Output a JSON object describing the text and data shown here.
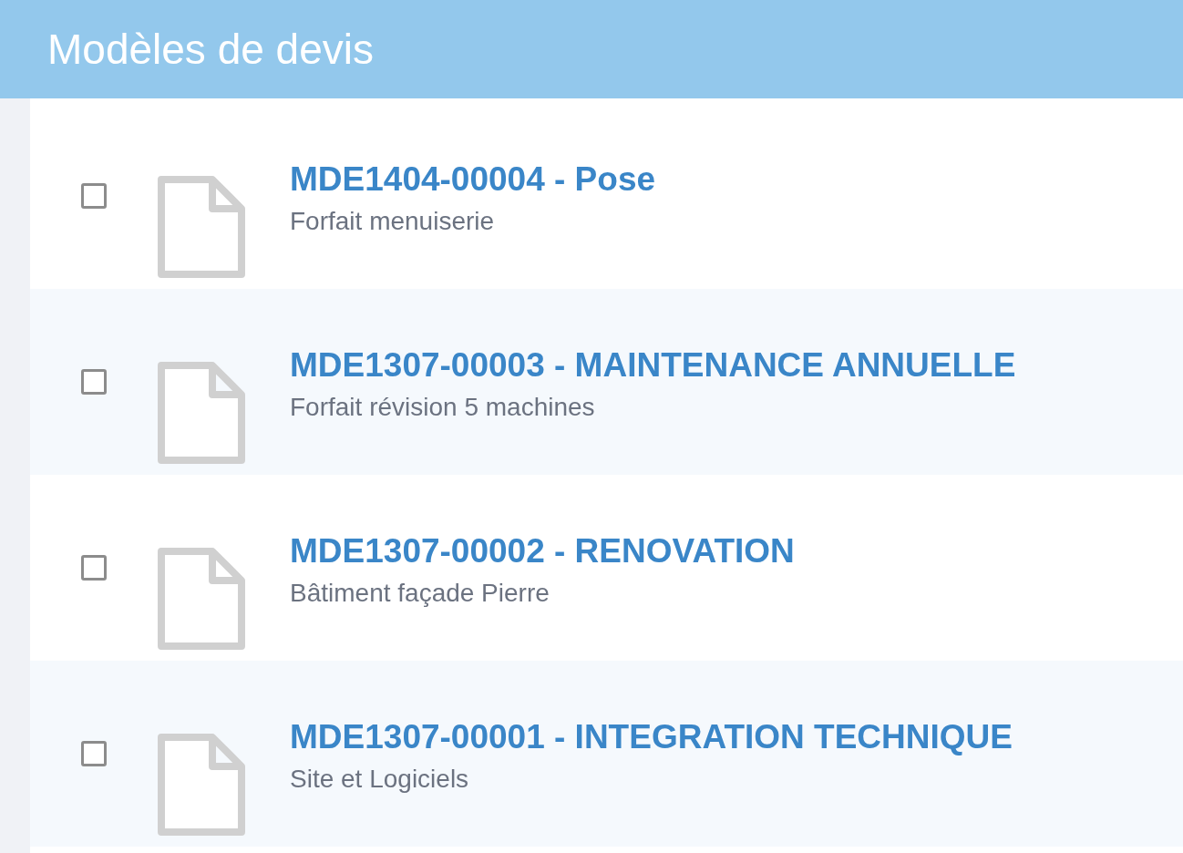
{
  "header": {
    "title": "Modèles de devis"
  },
  "items": [
    {
      "title": "MDE1404-00004 - Pose",
      "subtitle": "Forfait menuiserie",
      "checked": false
    },
    {
      "title": "MDE1307-00003 - MAINTENANCE ANNUELLE",
      "subtitle": "Forfait révision 5 machines",
      "checked": false
    },
    {
      "title": "MDE1307-00002 - RENOVATION",
      "subtitle": "Bâtiment façade Pierre",
      "checked": false
    },
    {
      "title": "MDE1307-00001 - INTEGRATION TECHNIQUE",
      "subtitle": "Site et Logiciels",
      "checked": false
    }
  ]
}
